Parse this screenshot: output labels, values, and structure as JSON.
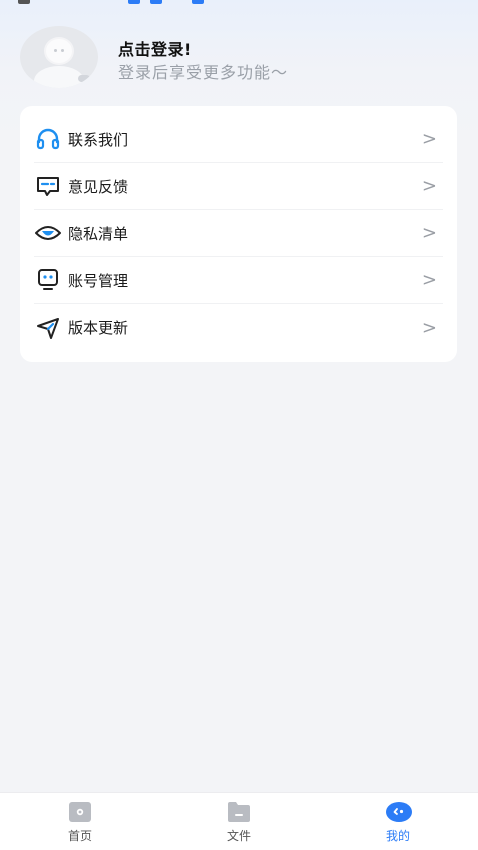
{
  "profile": {
    "title": "点击登录!",
    "subtitle": "登录后享受更多功能～"
  },
  "menu": {
    "items": [
      {
        "label": "联系我们",
        "icon": "headset-icon"
      },
      {
        "label": "意见反馈",
        "icon": "feedback-icon"
      },
      {
        "label": "隐私清单",
        "icon": "eye-icon"
      },
      {
        "label": "账号管理",
        "icon": "account-icon"
      },
      {
        "label": "版本更新",
        "icon": "send-icon"
      }
    ],
    "chevron": ">"
  },
  "bottom_nav": {
    "tabs": [
      {
        "label": "首页",
        "icon": "home-icon",
        "active": false
      },
      {
        "label": "文件",
        "icon": "folder-icon",
        "active": false
      },
      {
        "label": "我的",
        "icon": "mine-icon",
        "active": true
      }
    ]
  },
  "colors": {
    "accent": "#2c7cf6",
    "icon_blue": "#1e8ff0",
    "icon_dark": "#222222"
  }
}
